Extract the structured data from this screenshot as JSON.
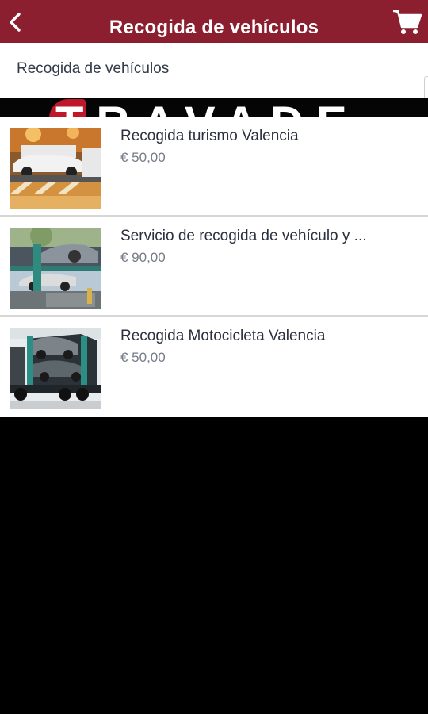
{
  "app_bar": {
    "title": "Recogida de vehículos",
    "back_icon": "chevron-left-icon",
    "cart_icon": "shopping-cart-icon",
    "color": "#8c1f2f"
  },
  "subheader": {
    "text": "Recogida de vehículos"
  },
  "banner": {
    "text": "TRAVADE"
  },
  "products": [
    {
      "title": "Recogida turismo Valencia",
      "price": "€ 50,00"
    },
    {
      "title": "Servicio de recogida de vehículo y ...",
      "price": "€ 90,00"
    },
    {
      "title": "Recogida Motocicleta Valencia",
      "price": "€ 50,00"
    }
  ]
}
